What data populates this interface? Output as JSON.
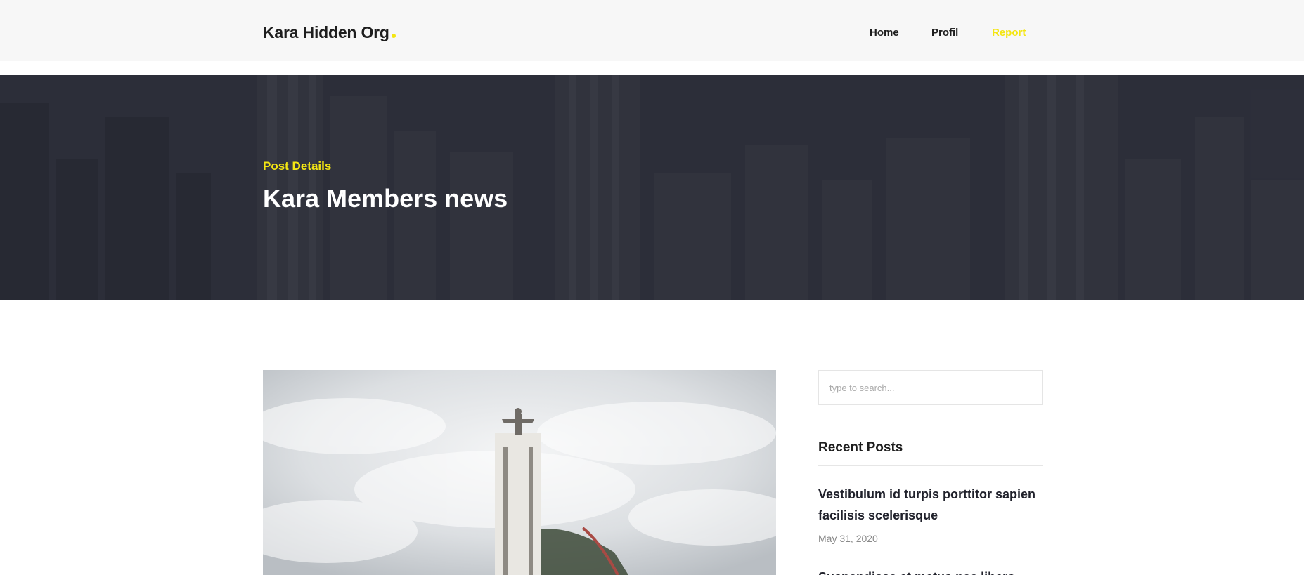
{
  "header": {
    "logo": "Kara Hidden Org",
    "nav": [
      {
        "label": "Home",
        "active": false
      },
      {
        "label": "Profil",
        "active": false
      },
      {
        "label": "Report",
        "active": true
      }
    ]
  },
  "hero": {
    "subtitle": "Post Details",
    "title": "Kara Members news"
  },
  "sidebar": {
    "search_placeholder": "type to search...",
    "recent_title": "Recent Posts",
    "recent_posts": [
      {
        "title": "Vestibulum id turpis porttitor sapien facilisis scelerisque",
        "date": "May 31, 2020"
      },
      {
        "title": "Suspendisse et metus nec libero",
        "date": ""
      }
    ]
  },
  "colors": {
    "accent": "#f4e613",
    "header_bg": "#f7f7f7",
    "hero_overlay": "#2a2c38",
    "text_dark": "#1e1e1e"
  }
}
